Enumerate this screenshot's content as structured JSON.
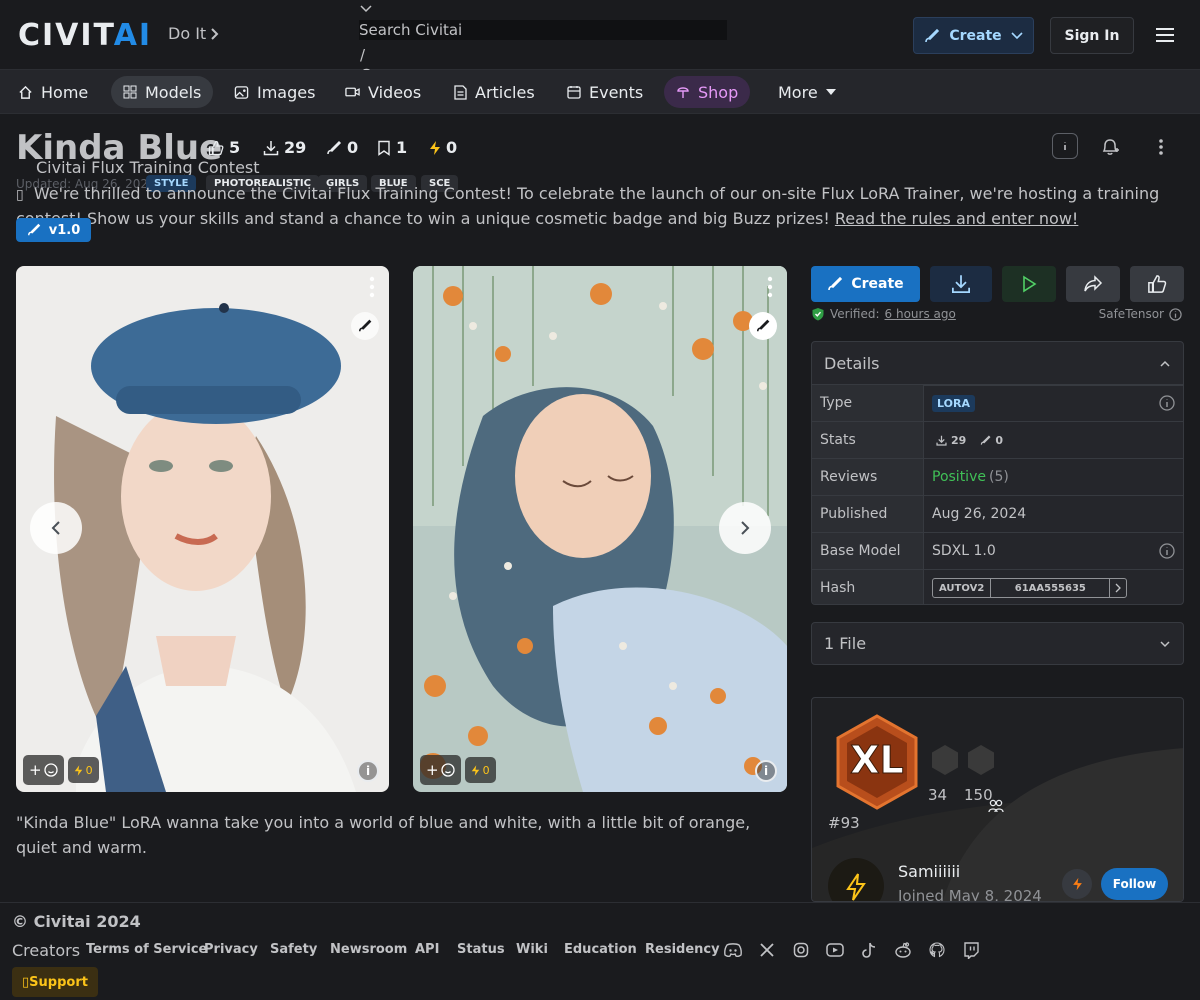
{
  "header": {
    "logo": "CIVITAI",
    "doit_label": "Do It",
    "search_placeholder": "Search Civitai",
    "search_shortcut": "/",
    "create_label": "Create",
    "signin_label": "Sign In"
  },
  "nav": {
    "items": [
      {
        "label": "Home",
        "icon": "home-icon"
      },
      {
        "label": "Models",
        "icon": "grid-icon"
      },
      {
        "label": "Images",
        "icon": "image-icon"
      },
      {
        "label": "Videos",
        "icon": "video-icon"
      },
      {
        "label": "Articles",
        "icon": "article-icon"
      },
      {
        "label": "Events",
        "icon": "calendar-icon"
      },
      {
        "label": "Shop",
        "icon": "shop-icon"
      },
      {
        "label": "More",
        "icon": "caret-down-icon"
      }
    ]
  },
  "model": {
    "title": "Kinda Blue",
    "stats": {
      "likes": "5",
      "downloads": "29",
      "generations": "0",
      "bookmarks": "1",
      "buzz": "0"
    },
    "contest_label": "Civitai Flux Training Contest",
    "updated": "Updated: Aug 26, 2024",
    "tags": [
      "STYLE",
      "PHOTOREALISTIC",
      "GIRLS",
      "BLUE",
      "SCE"
    ],
    "announcement": "We're thrilled to announce the Civitai Flux Training Contest! To celebrate the launch of our on-site Flux LoRA Trainer, we're hosting a training contest! Show us your skills and stand a chance to win a unique cosmetic badge and big Buzz prizes!",
    "announcement_link": "Read the rules and enter now!",
    "version": "v1.0",
    "description": "\"Kinda Blue\" LoRA wanna take you into a world of blue and white, with a little bit of orange, quiet and warm.",
    "image_buzz": "0"
  },
  "actions": {
    "create_label": "Create",
    "verified_label": "Verified:",
    "verified_time": "6 hours ago",
    "format": "SafeTensor"
  },
  "details": {
    "title": "Details",
    "rows": {
      "type_key": "Type",
      "type_val": "LORA",
      "stats_key": "Stats",
      "stats_downloads": "29",
      "stats_gens": "0",
      "reviews_key": "Reviews",
      "reviews_val": "Positive",
      "reviews_count": "(5)",
      "published_key": "Published",
      "published_val": "Aug 26, 2024",
      "base_key": "Base Model",
      "base_val": "SDXL 1.0",
      "hash_key": "Hash",
      "hash_type": "AUTOV2",
      "hash_val": "61AA555635"
    }
  },
  "files": {
    "label": "1 File"
  },
  "creator": {
    "badge": "XL",
    "count_a": "34",
    "count_b": "150",
    "rank": "#93",
    "name": "Samiiiiii",
    "joined": "Joined May 8, 2024",
    "follow_label": "Follow"
  },
  "footer": {
    "copyright": "© Civitai 2024",
    "creators": "Creators",
    "links": [
      "Terms of Service",
      "Privacy",
      "Safety",
      "Newsroom",
      "API",
      "Status",
      "Wiki",
      "Education",
      "Residency"
    ],
    "support": "Support"
  },
  "colors": {
    "accent": "#228be6",
    "positive": "#40c057",
    "shop": "#e599f7",
    "buzz": "#fcc419"
  }
}
